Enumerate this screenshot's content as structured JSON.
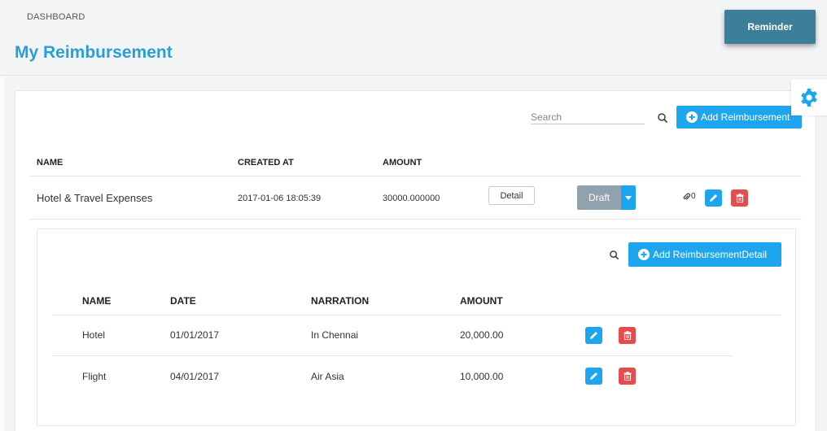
{
  "header": {
    "breadcrumb": "DASHBOARD",
    "title": "My Reimbursement",
    "reminder_label": "Reminder"
  },
  "toolbar": {
    "search_placeholder": "Search",
    "add_label": "Add Reimbursement"
  },
  "table": {
    "columns": [
      "NAME",
      "CREATED AT",
      "AMOUNT"
    ],
    "rows": [
      {
        "name": "Hotel & Travel Expenses",
        "created_at": "2017-01-06 18:05:39",
        "amount": "30000.000000",
        "detail_label": "Detail",
        "status_label": "Draft",
        "attachments": "0"
      }
    ]
  },
  "details": {
    "add_label": "Add ReimbursementDetail",
    "columns": [
      "NAME",
      "DATE",
      "NARRATION",
      "AMOUNT"
    ],
    "rows": [
      {
        "name": "Hotel",
        "date": "01/01/2017",
        "narration": "In Chennai",
        "amount": "20,000.00"
      },
      {
        "name": "Flight",
        "date": "04/01/2017",
        "narration": "Air Asia",
        "amount": "10,000.00"
      }
    ]
  },
  "colors": {
    "accent": "#1ea5f0",
    "title": "#2a9fd6",
    "reminder": "#3d7e99",
    "danger": "#e54d4d",
    "draft": "#8fa2ad"
  }
}
